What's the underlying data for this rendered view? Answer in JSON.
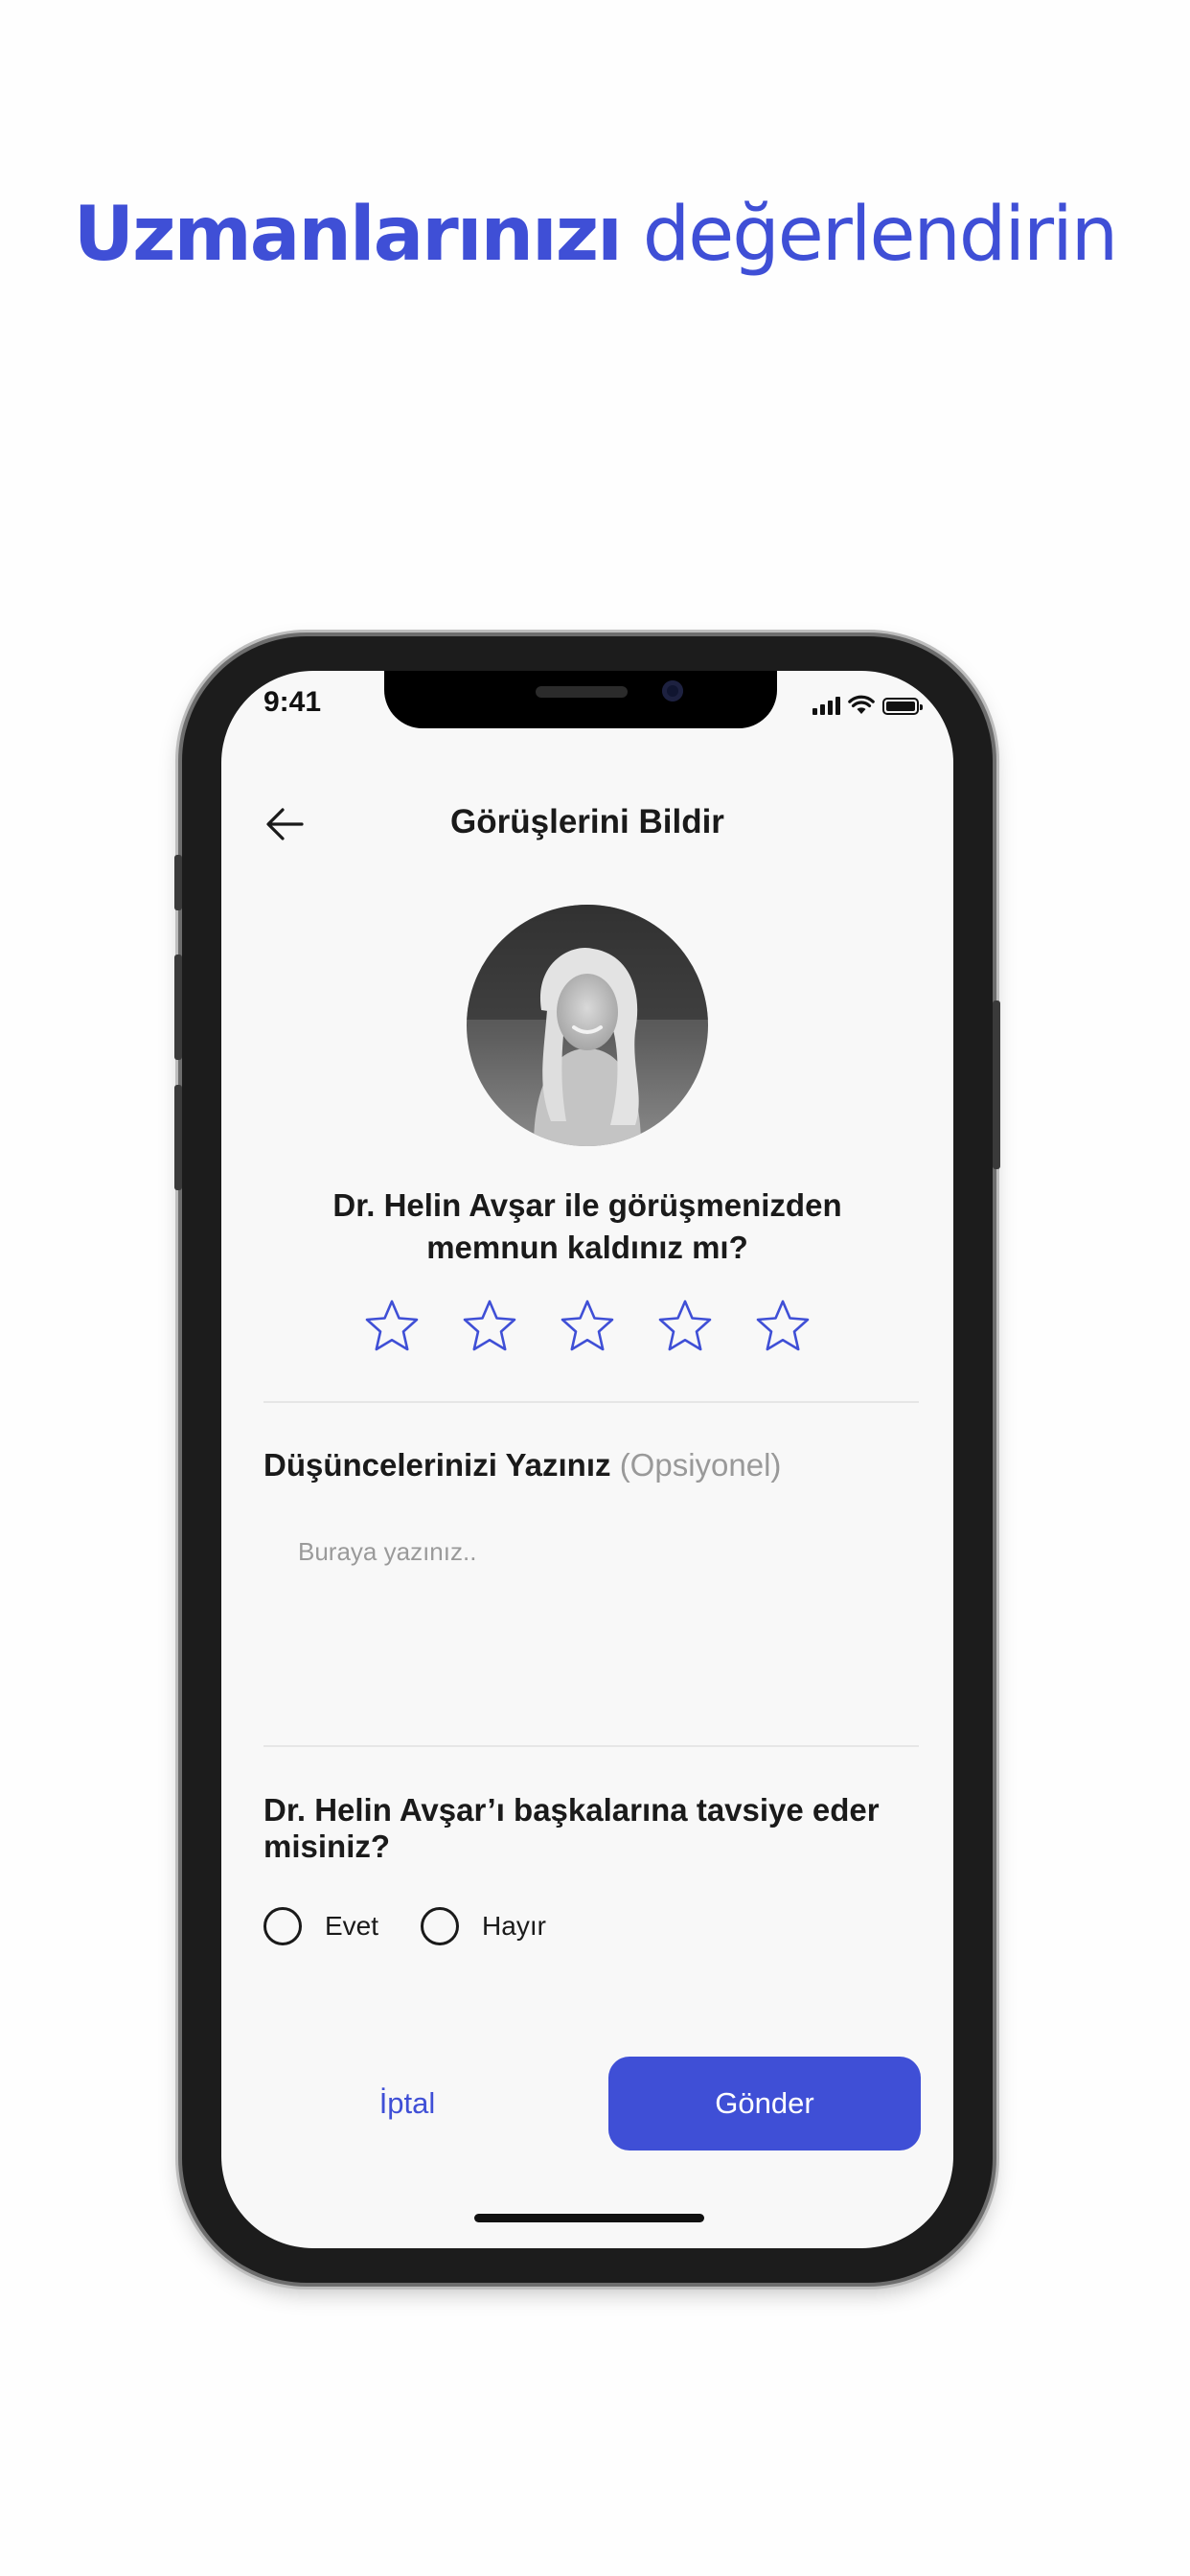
{
  "headline": {
    "bold": "Uzmanlarınızı",
    "light": "değerlendirin"
  },
  "status_bar": {
    "time": "9:41"
  },
  "nav": {
    "title": "Görüşlerini Bildir",
    "back_icon": "arrow-left-icon"
  },
  "expert": {
    "question_line1": "Dr. Helin Avşar ile görüşmenizden",
    "question_line2": "memnun kaldınız mı?"
  },
  "rating": {
    "max": 5,
    "value": 0,
    "icon": "star-outline-icon"
  },
  "feedback": {
    "label": "Düşüncelerinizi Yazınız",
    "optional": "(Opsiyonel)",
    "placeholder": "Buraya yazınız.."
  },
  "recommend": {
    "question": "Dr. Helin Avşar’ı başkalarına tavsiye eder misiniz?",
    "options": [
      "Evet",
      "Hayır"
    ]
  },
  "actions": {
    "cancel": "İptal",
    "submit": "Gönder"
  },
  "colors": {
    "accent": "#3f4fd6",
    "background": "#f8f8f8",
    "text": "#1a1a1a",
    "muted": "#999999"
  }
}
